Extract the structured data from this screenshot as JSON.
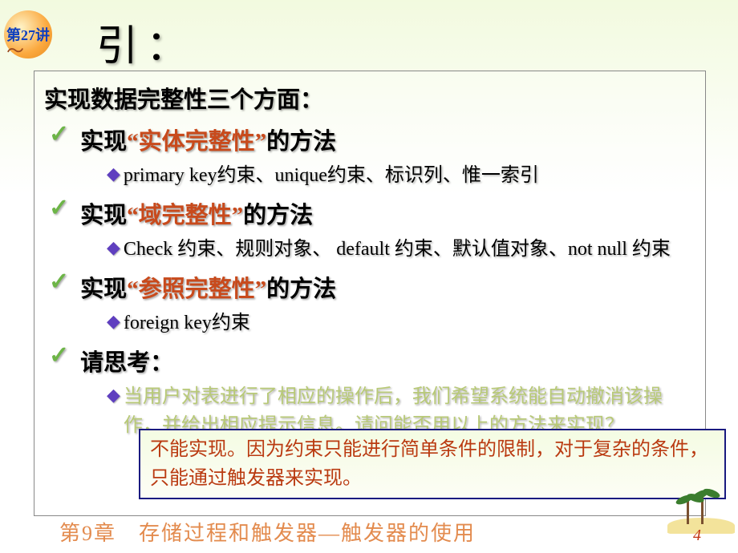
{
  "lecture_badge": "第27讲",
  "title": "引：",
  "main_heading": "实现数据完整性三个方面：",
  "items": [
    {
      "prefix": "实现",
      "quote_open": "“",
      "highlight": "实体完整性",
      "quote_close": "”",
      "suffix": "的方法",
      "sub": "primary  key约束、unique约束、标识列、惟一索引"
    },
    {
      "prefix": "实现",
      "quote_open": "“",
      "highlight": "域完整性",
      "quote_close": "”",
      "suffix": "的方法",
      "sub": "Check 约束、规则对象、 default  约束、默认值对象、not  null 约束"
    },
    {
      "prefix": "实现",
      "quote_open": "“",
      "highlight": "参照完整性",
      "quote_close": "”",
      "suffix": "的方法",
      "sub": "foreign key约束"
    },
    {
      "prefix": "请思考：",
      "quote_open": "",
      "highlight": "",
      "quote_close": "",
      "suffix": "",
      "sub_faded": "当用户对表进行了相应的操作后，我们希望系统能自动撤消该操作，并给出相应提示信息。请问能否用以上的方法来实现？"
    }
  ],
  "overlay_text": "不能实现。因为约束只能进行简单条件的限制，对于复杂的条件，只能通过触发器来实现。",
  "footer_title": "第9章　存储过程和触发器—触发器的使用",
  "page_number": "4"
}
